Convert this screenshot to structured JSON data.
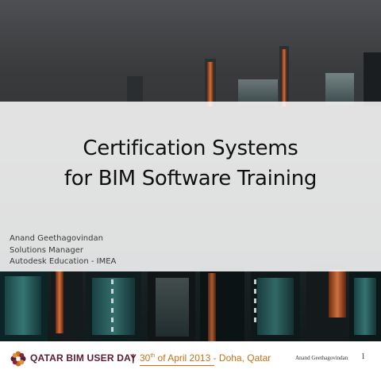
{
  "slide": {
    "title_lines": [
      "Certification Systems",
      "for BIM Software Training"
    ],
    "presenter": {
      "name": "Anand Geethagovindan",
      "role": "Solutions Manager",
      "organization": "Autodesk Education - IMEA"
    }
  },
  "footer": {
    "event": "QATAR BIM USER DAY",
    "separator": "|",
    "date_day": "30",
    "date_suffix": "th",
    "date_rest": " of April 2013 - Doha, Qatar",
    "author": "Anand Geethagovindan",
    "page_number": "1",
    "logo_icon": "qatar-bim-flower-logo"
  },
  "colors": {
    "event_text": "#5c1a33",
    "date_text": "#c8701a",
    "title_text": "#111111"
  }
}
